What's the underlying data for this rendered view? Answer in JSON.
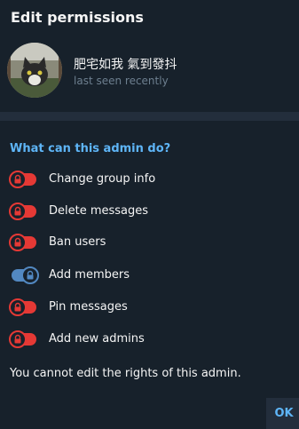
{
  "dialog": {
    "title": "Edit permissions"
  },
  "user": {
    "name": "肥宅如我 氣到發抖",
    "status": "last seen recently"
  },
  "section": {
    "title": "What can this admin do?"
  },
  "permissions": [
    {
      "label": "Change group info",
      "enabled": false
    },
    {
      "label": "Delete messages",
      "enabled": false
    },
    {
      "label": "Ban users",
      "enabled": false
    },
    {
      "label": "Add members",
      "enabled": true
    },
    {
      "label": "Pin messages",
      "enabled": false
    },
    {
      "label": "Add new admins",
      "enabled": false
    }
  ],
  "note": "You cannot edit the rights of this admin.",
  "buttons": {
    "ok": "OK"
  },
  "colors": {
    "accent": "#5eb5f7",
    "toggle_on": "#5288c1",
    "toggle_off": "#e53935",
    "background": "#17212b"
  },
  "icons": {
    "toggle": "lock-icon"
  }
}
